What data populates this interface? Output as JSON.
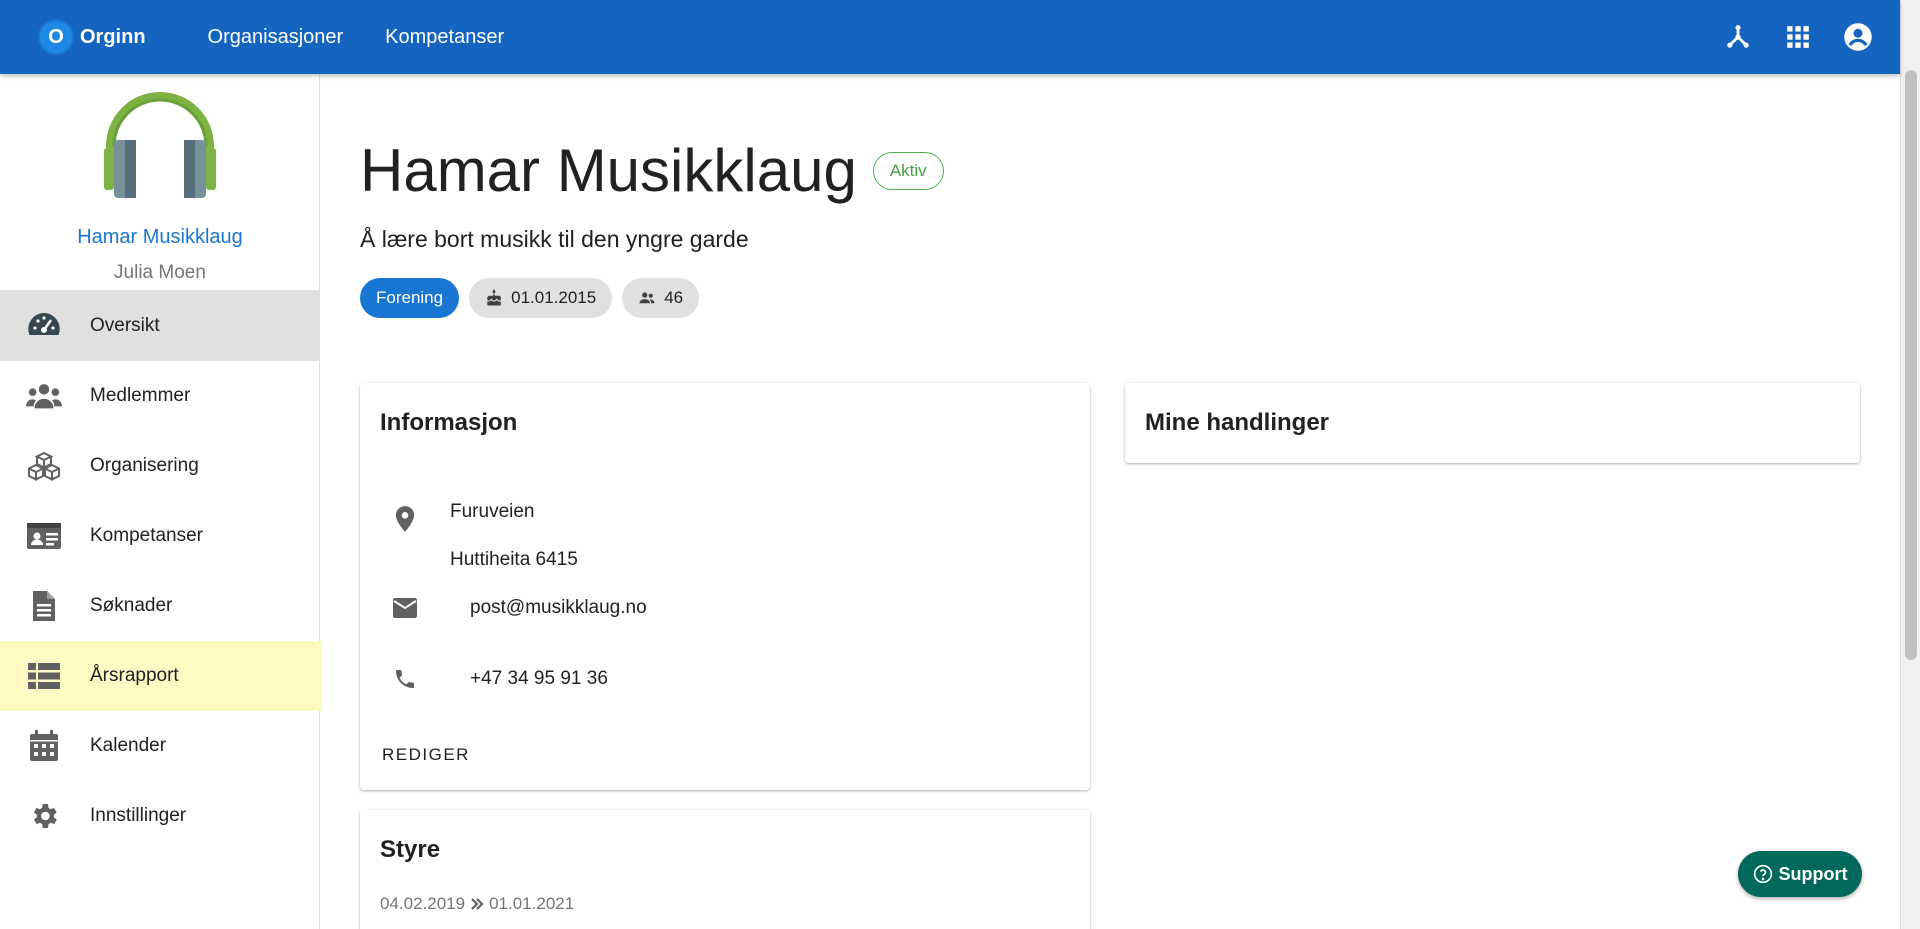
{
  "brand": {
    "logo_letter": "O",
    "name": "Orginn"
  },
  "topnav": [
    {
      "label": "Organisasjoner"
    },
    {
      "label": "Kompetanser"
    }
  ],
  "top_icons": [
    "hierarchy-icon",
    "apps-grid-icon",
    "account-circle-icon"
  ],
  "sidebar": {
    "org_name": "Hamar Musikklaug",
    "user_name": "Julia Moen",
    "items": [
      {
        "label": "Oversikt",
        "icon": "dashboard-gauge-icon",
        "state": "active"
      },
      {
        "label": "Medlemmer",
        "icon": "people-icon",
        "state": ""
      },
      {
        "label": "Organisering",
        "icon": "cubes-icon",
        "state": ""
      },
      {
        "label": "Kompetanser",
        "icon": "id-card-icon",
        "state": ""
      },
      {
        "label": "Søknader",
        "icon": "document-icon",
        "state": ""
      },
      {
        "label": "Årsrapport",
        "icon": "list-icon",
        "state": "highlight"
      },
      {
        "label": "Kalender",
        "icon": "calendar-icon",
        "state": ""
      },
      {
        "label": "Innstillinger",
        "icon": "gear-icon",
        "state": ""
      }
    ]
  },
  "main": {
    "title": "Hamar Musikklaug",
    "status": "Aktiv",
    "subtitle": "Å lære bort musikk til den yngre garde",
    "chips": {
      "type": "Forening",
      "founded": "01.01.2015",
      "members": "46"
    }
  },
  "info_card": {
    "title": "Informasjon",
    "address_line1": "Furuveien",
    "address_line2": "Huttiheita 6415",
    "email": "post@musikklaug.no",
    "phone": "+47 34 95 91 36",
    "edit_label": "REDIGER"
  },
  "actions_card": {
    "title": "Mine handlinger"
  },
  "board_card": {
    "title": "Styre",
    "date_from": "04.02.2019",
    "date_to": "01.01.2021"
  },
  "support": {
    "label": "Support"
  },
  "colors": {
    "primary": "#1565c0",
    "accent_blue": "#1976d2",
    "active_green": "#43a047",
    "support_teal": "#00695c",
    "highlight_yellow": "#fff9c4"
  }
}
